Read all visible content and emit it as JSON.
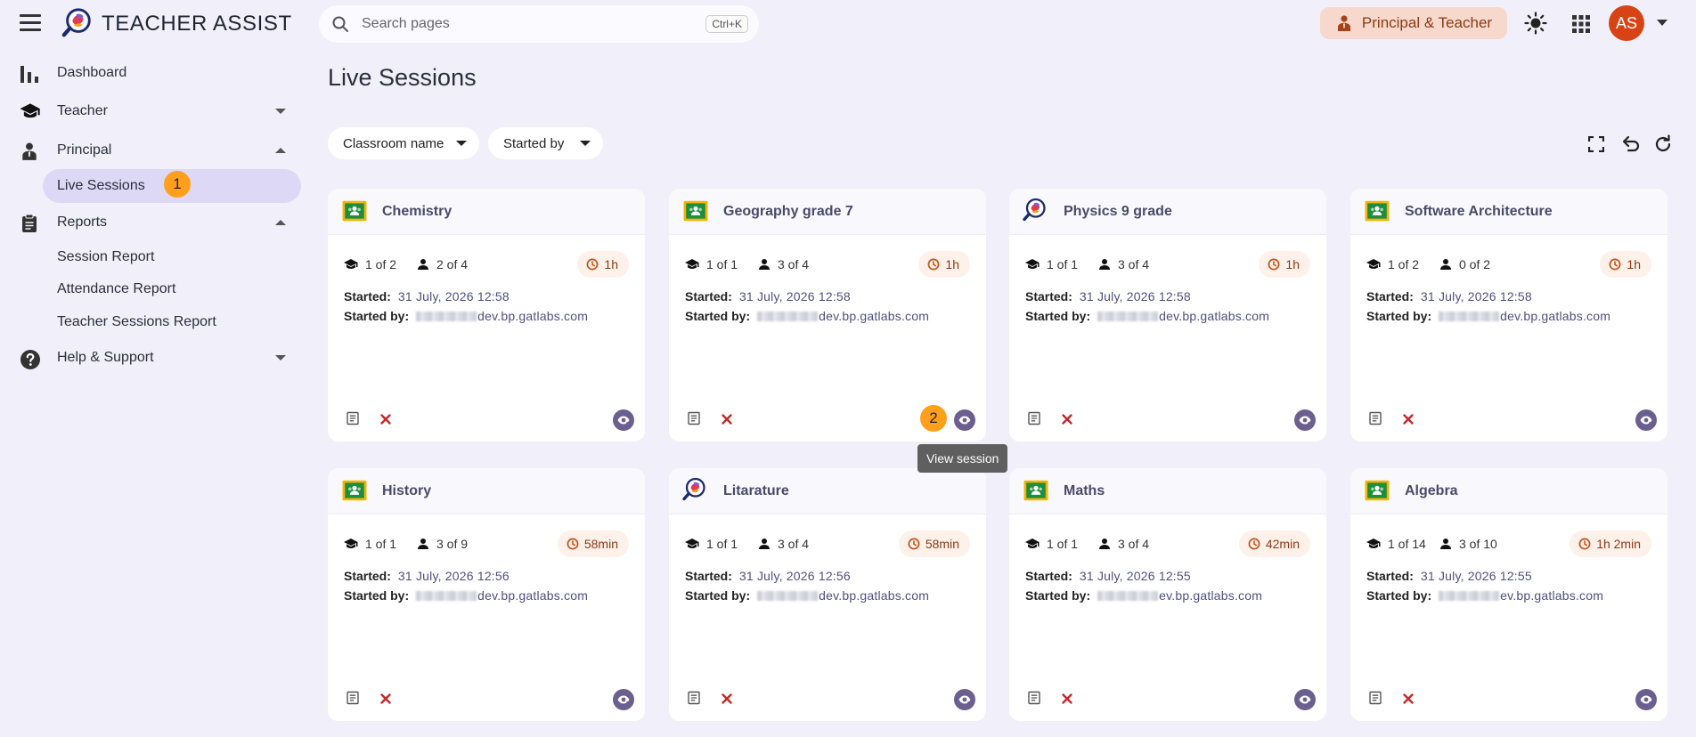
{
  "app": {
    "title": "TEACHER ASSIST"
  },
  "search": {
    "placeholder": "Search pages",
    "shortcut": "Ctrl+K"
  },
  "role": {
    "label": "Principal & Teacher"
  },
  "user": {
    "initials": "AS"
  },
  "sidebar": {
    "items": [
      {
        "label": "Dashboard"
      },
      {
        "label": "Teacher"
      },
      {
        "label": "Principal",
        "children": [
          {
            "label": "Live Sessions"
          }
        ]
      },
      {
        "label": "Reports",
        "children": [
          {
            "label": "Session Report"
          },
          {
            "label": "Attendance Report"
          },
          {
            "label": "Teacher Sessions Report"
          }
        ]
      },
      {
        "label": "Help & Support"
      }
    ]
  },
  "markers": {
    "first": "1",
    "second": "2"
  },
  "page": {
    "title": "Live Sessions"
  },
  "filters": {
    "classroom": "Classroom name",
    "started_by": "Started by"
  },
  "labels": {
    "started": "Started:",
    "started_by": "Started by:"
  },
  "tooltip": "View session",
  "colors": {
    "accent": "#dcd8f6",
    "chip": "#f6d9cc",
    "avatar": "#d84315",
    "view": "#6a5f8f",
    "close": "#c62828",
    "marker": "#ff9f1c"
  },
  "sessions": [
    {
      "title": "Chemistry",
      "icon": "classroom-icon",
      "teachers": "1 of 2",
      "students": "2 of 4",
      "duration": "1h",
      "started": "31 July, 2026 12:58",
      "started_by": "dev.bp.gatlabs.com"
    },
    {
      "title": "Geography grade 7",
      "icon": "classroom-icon",
      "teachers": "1 of 1",
      "students": "3 of 4",
      "duration": "1h",
      "started": "31 July, 2026 12:58",
      "started_by": "dev.bp.gatlabs.com"
    },
    {
      "title": "Physics 9 grade",
      "icon": "teacher-assist-logo-icon",
      "teachers": "1 of 1",
      "students": "3 of 4",
      "duration": "1h",
      "started": "31 July, 2026 12:58",
      "started_by": "dev.bp.gatlabs.com"
    },
    {
      "title": "Software Architecture",
      "icon": "classroom-icon",
      "teachers": "1 of 2",
      "students": "0 of 2",
      "duration": "1h",
      "started": "31 July, 2026 12:58",
      "started_by": "dev.bp.gatlabs.com"
    },
    {
      "title": "History",
      "icon": "classroom-icon",
      "teachers": "1 of 1",
      "students": "3 of 9",
      "duration": "58min",
      "started": "31 July, 2026 12:56",
      "started_by": "dev.bp.gatlabs.com"
    },
    {
      "title": "Litarature",
      "icon": "teacher-assist-logo-icon",
      "teachers": "1 of 1",
      "students": "3 of 4",
      "duration": "58min",
      "started": "31 July, 2026 12:56",
      "started_by": "dev.bp.gatlabs.com"
    },
    {
      "title": "Maths",
      "icon": "classroom-icon",
      "teachers": "1 of 1",
      "students": "3 of 4",
      "duration": "42min",
      "started": "31 July, 2026 12:55",
      "started_by": "ev.bp.gatlabs.com"
    },
    {
      "title": "Algebra",
      "icon": "classroom-icon",
      "teachers": "1 of 14",
      "students": "3 of 10",
      "duration": "1h 2min",
      "started": "31 July, 2026 12:55",
      "started_by": "ev.bp.gatlabs.com"
    }
  ]
}
